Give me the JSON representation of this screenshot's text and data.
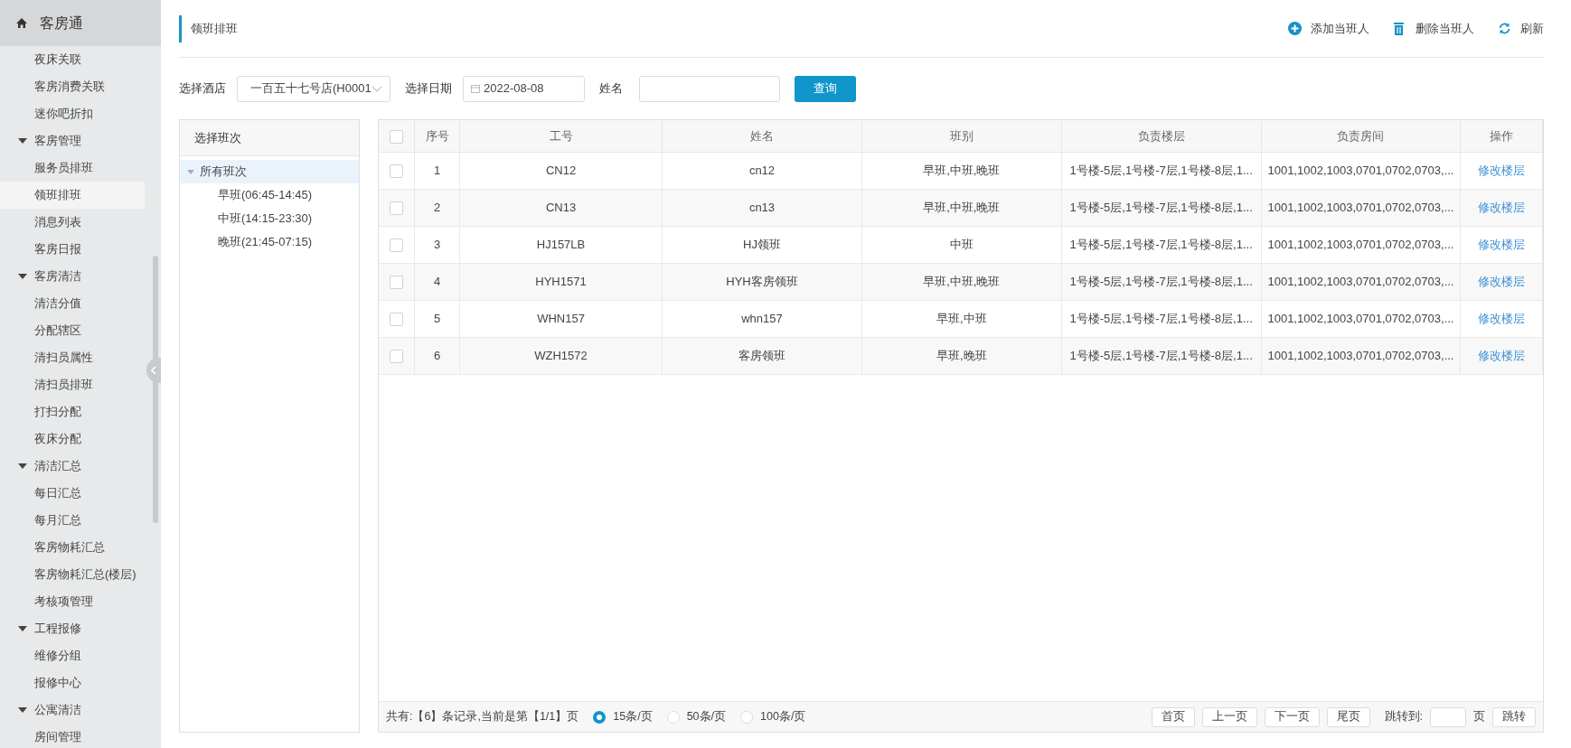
{
  "sidebar": {
    "title": "客房通",
    "items": [
      {
        "kind": "item",
        "label": "夜床关联",
        "selected": false
      },
      {
        "kind": "item",
        "label": "客房消费关联",
        "selected": false
      },
      {
        "kind": "item",
        "label": "迷你吧折扣",
        "selected": false
      },
      {
        "kind": "group",
        "label": "客房管理",
        "selected": false
      },
      {
        "kind": "item",
        "label": "服务员排班",
        "selected": false
      },
      {
        "kind": "item",
        "label": "领班排班",
        "selected": true
      },
      {
        "kind": "item",
        "label": "消息列表",
        "selected": false
      },
      {
        "kind": "item",
        "label": "客房日报",
        "selected": false
      },
      {
        "kind": "group",
        "label": "客房清洁",
        "selected": false
      },
      {
        "kind": "item",
        "label": "清洁分值",
        "selected": false
      },
      {
        "kind": "item",
        "label": "分配辖区",
        "selected": false
      },
      {
        "kind": "item",
        "label": "清扫员属性",
        "selected": false
      },
      {
        "kind": "item",
        "label": "清扫员排班",
        "selected": false
      },
      {
        "kind": "item",
        "label": "打扫分配",
        "selected": false
      },
      {
        "kind": "item",
        "label": "夜床分配",
        "selected": false
      },
      {
        "kind": "group",
        "label": "清洁汇总",
        "selected": false
      },
      {
        "kind": "item",
        "label": "每日汇总",
        "selected": false
      },
      {
        "kind": "item",
        "label": "每月汇总",
        "selected": false
      },
      {
        "kind": "item",
        "label": "客房物耗汇总",
        "selected": false
      },
      {
        "kind": "item",
        "label": "客房物耗汇总(楼层)",
        "selected": false
      },
      {
        "kind": "item",
        "label": "考核项管理",
        "selected": false
      },
      {
        "kind": "group",
        "label": "工程报修",
        "selected": false
      },
      {
        "kind": "item",
        "label": "维修分组",
        "selected": false
      },
      {
        "kind": "item",
        "label": "报修中心",
        "selected": false
      },
      {
        "kind": "group",
        "label": "公寓清洁",
        "selected": false
      },
      {
        "kind": "item",
        "label": "房间管理",
        "selected": false
      }
    ]
  },
  "page_title": "领班排班",
  "toolbar": [
    {
      "kind": "add",
      "label": "添加当班人"
    },
    {
      "kind": "delete",
      "label": "删除当班人"
    },
    {
      "kind": "refresh",
      "label": "刷新"
    }
  ],
  "filters": {
    "hotel_label": "选择酒店",
    "hotel_value": "一百五十七号店(H0001",
    "date_label": "选择日期",
    "date_value": "2022-08-08",
    "name_label": "姓名",
    "query_button": "查询"
  },
  "shift_panel": {
    "title": "选择班次",
    "tree": [
      {
        "label": "所有班次",
        "selected": true,
        "expanded": true,
        "children": [
          {
            "label": "早班(06:45-14:45)",
            "selected": false
          },
          {
            "label": "中班(14:15-23:30)",
            "selected": false
          },
          {
            "label": "晚班(21:45-07:15)",
            "selected": false
          }
        ]
      }
    ]
  },
  "table": {
    "all_checked": false,
    "columns": [
      "序号",
      "工号",
      "姓名",
      "班别",
      "负责楼层",
      "负责房间",
      "操作"
    ],
    "rows": [
      {
        "checked": false,
        "cells": [
          "1",
          "CN12",
          "cn12",
          "早班,中班,晚班",
          "1号楼-5层,1号楼-7层,1号楼-8层,1...",
          "1001,1002,1003,0701,0702,0703,...",
          "修改楼层"
        ]
      },
      {
        "checked": false,
        "cells": [
          "2",
          "CN13",
          "cn13",
          "早班,中班,晚班",
          "1号楼-5层,1号楼-7层,1号楼-8层,1...",
          "1001,1002,1003,0701,0702,0703,...",
          "修改楼层"
        ]
      },
      {
        "checked": false,
        "cells": [
          "3",
          "HJ157LB",
          "HJ领班",
          "中班",
          "1号楼-5层,1号楼-7层,1号楼-8层,1...",
          "1001,1002,1003,0701,0702,0703,...",
          "修改楼层"
        ]
      },
      {
        "checked": false,
        "cells": [
          "4",
          "HYH1571",
          "HYH客房领班",
          "早班,中班,晚班",
          "1号楼-5层,1号楼-7层,1号楼-8层,1...",
          "1001,1002,1003,0701,0702,0703,...",
          "修改楼层"
        ]
      },
      {
        "checked": false,
        "cells": [
          "5",
          "WHN157",
          "whn157",
          "早班,中班",
          "1号楼-5层,1号楼-7层,1号楼-8层,1...",
          "1001,1002,1003,0701,0702,0703,...",
          "修改楼层"
        ]
      },
      {
        "checked": false,
        "cells": [
          "6",
          "WZH1572",
          "客房领班",
          "早班,晚班",
          "1号楼-5层,1号楼-7层,1号楼-8层,1...",
          "1001,1002,1003,0701,0702,0703,...",
          "修改楼层"
        ]
      }
    ]
  },
  "pager": {
    "summary": "共有:【6】条记录,当前是第【1/1】页",
    "sizes": [
      {
        "label": "15条/页",
        "selected": true
      },
      {
        "label": "50条/页",
        "selected": false
      },
      {
        "label": "100条/页",
        "selected": false
      }
    ],
    "buttons": [
      "首页",
      "上一页",
      "下一页",
      "尾页"
    ],
    "jump_label": "跳转到:",
    "page_unit": "页",
    "jump_button": "跳转"
  }
}
